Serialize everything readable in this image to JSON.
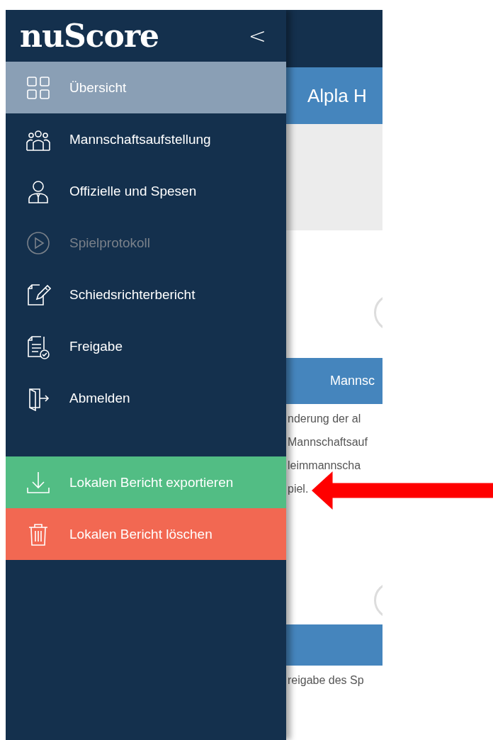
{
  "sidebar": {
    "logo": "nuScore",
    "collapse": "<",
    "items": [
      {
        "label": "Übersicht",
        "selected": true,
        "disabled": false
      },
      {
        "label": "Mannschaftsaufstellung",
        "selected": false,
        "disabled": false
      },
      {
        "label": "Offizielle und Spesen",
        "selected": false,
        "disabled": false
      },
      {
        "label": "Spielprotokoll",
        "selected": false,
        "disabled": true
      },
      {
        "label": "Schiedsrichterbericht",
        "selected": false,
        "disabled": false
      },
      {
        "label": "Freigabe",
        "selected": false,
        "disabled": false
      },
      {
        "label": "Abmelden",
        "selected": false,
        "disabled": false
      }
    ],
    "actions": [
      {
        "label": "Lokalen Bericht exportieren",
        "color": "#52bd84"
      },
      {
        "label": "Lokalen Bericht löschen",
        "color": "#f26852"
      }
    ]
  },
  "content": {
    "title": "Alpla H",
    "section_1": "Mannsc",
    "lines_1": [
      "nderung der al",
      "Mannschaftsauf",
      "leimmannscha",
      "piel."
    ],
    "lines_2": [
      "reigabe des Sp"
    ]
  }
}
